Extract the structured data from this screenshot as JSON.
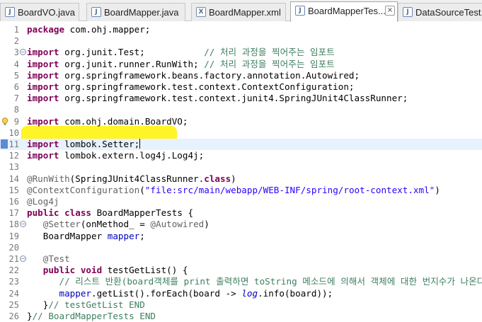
{
  "tabs": [
    {
      "label": "BoardVO.java",
      "icon": "java-file-icon",
      "icon_glyph": "J",
      "close": "×",
      "active": false
    },
    {
      "label": "BoardMapper.java",
      "icon": "java-file-icon",
      "icon_glyph": "J",
      "close": "×",
      "active": false
    },
    {
      "label": "BoardMapper.xml",
      "icon": "xml-file-icon",
      "icon_glyph": "X",
      "close": "×",
      "active": false
    },
    {
      "label": "BoardMapperTes...",
      "icon": "java-file-icon",
      "icon_glyph": "J",
      "close": "×",
      "active": true
    },
    {
      "label": "DataSourceTest...",
      "icon": "java-file-icon",
      "icon_glyph": "J",
      "close": "",
      "active": false
    }
  ],
  "editor": {
    "fold_glyph": "−",
    "line_numbers": [
      "1",
      "2",
      "3",
      "4",
      "5",
      "6",
      "7",
      "8",
      "9",
      "10",
      "11",
      "12",
      "13",
      "14",
      "15",
      "16",
      "17",
      "18",
      "19",
      "20",
      "21",
      "22",
      "23",
      "24",
      "25",
      "26"
    ],
    "lines": [
      [
        {
          "t": "package",
          "c": "kw"
        },
        {
          "t": " com.ohj.mapper;"
        }
      ],
      [],
      [
        {
          "t": "import",
          "c": "kw"
        },
        {
          "t": " org.junit.Test;           "
        },
        {
          "t": "// 처리 과정을 찍어주는 임포트",
          "c": "cm"
        }
      ],
      [
        {
          "t": "import",
          "c": "kw"
        },
        {
          "t": " org.junit.runner.RunWith; "
        },
        {
          "t": "// 처리 과정을 찍어주는 임포트",
          "c": "cm"
        }
      ],
      [
        {
          "t": "import",
          "c": "kw"
        },
        {
          "t": " org.springframework.beans.factory.annotation.Autowired;"
        }
      ],
      [
        {
          "t": "import",
          "c": "kw"
        },
        {
          "t": " org.springframework.test.context.ContextConfiguration;"
        }
      ],
      [
        {
          "t": "import",
          "c": "kw"
        },
        {
          "t": " org.springframework.test.context.junit4.SpringJUnit4ClassRunner;"
        }
      ],
      [],
      [
        {
          "t": "import",
          "c": "kw"
        },
        {
          "t": " com.ohj.domain.BoardVO;"
        }
      ],
      [],
      [
        {
          "t": "import",
          "c": "kw"
        },
        {
          "t": " lombok.Setter;"
        }
      ],
      [
        {
          "t": "import",
          "c": "kw"
        },
        {
          "t": " lombok.extern.log4j.Log4j;"
        }
      ],
      [],
      [
        {
          "t": "@RunWith",
          "c": "an"
        },
        {
          "t": "(SpringJUnit4ClassRunner."
        },
        {
          "t": "class",
          "c": "kw"
        },
        {
          "t": ")"
        }
      ],
      [
        {
          "t": "@ContextConfiguration",
          "c": "an"
        },
        {
          "t": "("
        },
        {
          "t": "\"file:src/main/webapp/WEB-INF/spring/root-context.xml\"",
          "c": "st"
        },
        {
          "t": ")"
        }
      ],
      [
        {
          "t": "@Log4j",
          "c": "an"
        }
      ],
      [
        {
          "t": "public",
          "c": "kw"
        },
        {
          "t": " "
        },
        {
          "t": "class",
          "c": "kw"
        },
        {
          "t": " BoardMapperTests {"
        }
      ],
      [
        {
          "t": "   "
        },
        {
          "t": "@Setter",
          "c": "an"
        },
        {
          "t": "(onMethod_ = "
        },
        {
          "t": "@Autowired",
          "c": "an"
        },
        {
          "t": ")"
        }
      ],
      [
        {
          "t": "   BoardMapper "
        },
        {
          "t": "mapper",
          "c": "fld"
        },
        {
          "t": ";"
        }
      ],
      [],
      [
        {
          "t": "   "
        },
        {
          "t": "@Test",
          "c": "an"
        }
      ],
      [
        {
          "t": "   "
        },
        {
          "t": "public",
          "c": "kw"
        },
        {
          "t": " "
        },
        {
          "t": "void",
          "c": "kw"
        },
        {
          "t": " testGetList() {"
        }
      ],
      [
        {
          "t": "      "
        },
        {
          "t": "// 리스트 반환(board객체를 print 출력하면 toString 메소드에 의해서 객체에 대한 번지수가 나온다.)",
          "c": "cm"
        }
      ],
      [
        {
          "t": "      "
        },
        {
          "t": "mapper",
          "c": "fld"
        },
        {
          "t": ".getList().forEach(board -> "
        },
        {
          "t": "log",
          "c": "fld it"
        },
        {
          "t": ".info(board));"
        }
      ],
      [
        {
          "t": "   }"
        },
        {
          "t": "// testGetList END",
          "c": "cm"
        }
      ],
      [
        {
          "t": "}"
        },
        {
          "t": "// BoardMapperTests END",
          "c": "cm"
        }
      ]
    ]
  }
}
